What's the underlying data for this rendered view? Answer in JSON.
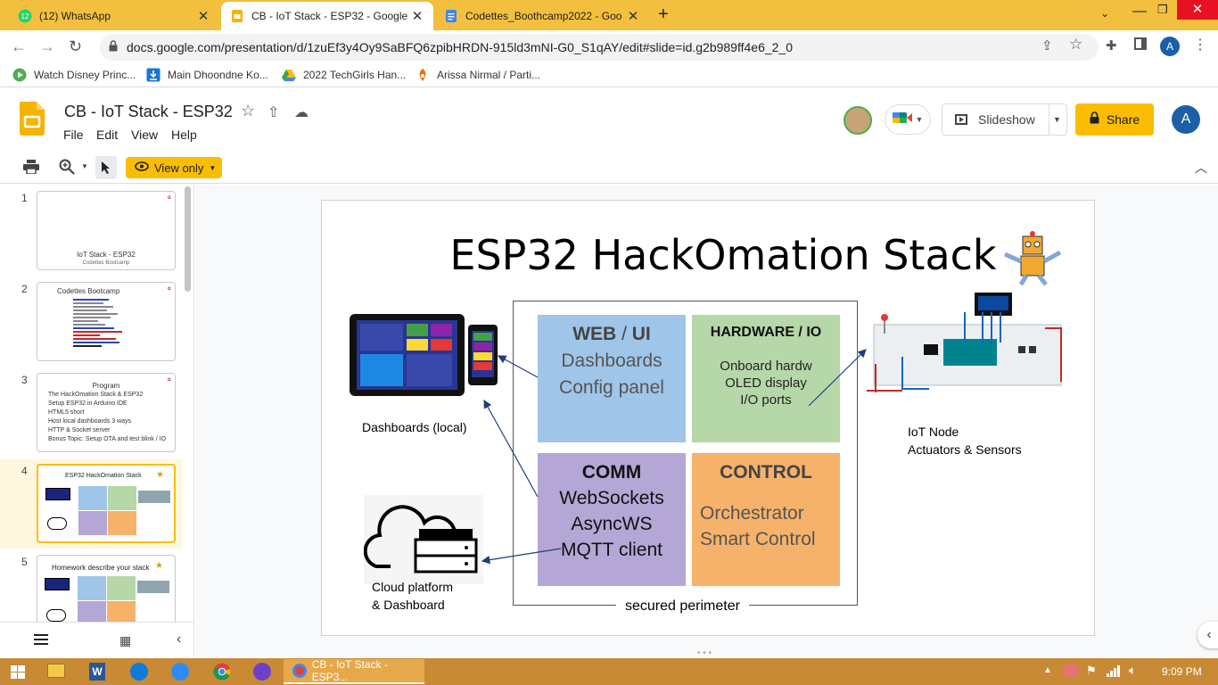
{
  "browser": {
    "tabs": [
      {
        "label": "(12) WhatsApp",
        "icon": "whatsapp-icon",
        "badge": "12"
      },
      {
        "label": "CB - IoT Stack - ESP32 - Google S",
        "icon": "slides-icon"
      },
      {
        "label": "Codettes_Boothcamp2022 - Goo",
        "icon": "docs-icon"
      }
    ],
    "url": "docs.google.com/presentation/d/1zuEf3y4Oy9SaBFQ6zpibHRDN-915ld3mNI-G0_S1qAY/edit#slide=id.g2b989ff4e6_2_0",
    "profile_letter": "A",
    "bookmarks": [
      {
        "label": "Watch Disney Princ..."
      },
      {
        "label": "Main Dhoondne Ko..."
      },
      {
        "label": "2022 TechGirls Han..."
      },
      {
        "label": "Arissa Nirmal / Parti..."
      }
    ]
  },
  "app": {
    "doc_title": "CB - IoT Stack - ESP32",
    "menus": [
      "File",
      "Edit",
      "View",
      "Help"
    ],
    "slideshow_label": "Slideshow",
    "share_label": "Share",
    "account_letter": "A",
    "view_only_label": "View only",
    "brand_color": "#f4b400"
  },
  "filmstrip": {
    "slides": [
      {
        "num": "1",
        "title": "IoT Stack - ESP32",
        "subtitle": "Codettes Bootcamp"
      },
      {
        "num": "2",
        "title": "Codettes Bootcamp"
      },
      {
        "num": "3",
        "title": "Program",
        "bullets": [
          "The HackOmation Stack & ESP32",
          "Setup ESP32 in Arduino IDE",
          "HTML5 short",
          "Host local dashboards 3 ways",
          "HTTP & Socket server",
          "Bonus Topic: Setup OTA and test blink / IO"
        ]
      },
      {
        "num": "4",
        "title": "ESP32 HackOmation Stack"
      },
      {
        "num": "5",
        "title": "Homework describe your stack"
      }
    ]
  },
  "slide": {
    "title": "ESP32 HackOmation Stack",
    "blocks": {
      "web": {
        "head1": "WEB",
        "sep": "/",
        "head2": "UI",
        "line1": "Dashboards",
        "line2": "Config panel",
        "color": "#9fc5e8"
      },
      "hardware": {
        "head": "HARDWARE / IO",
        "line1": "Onboard hardw",
        "line2": "OLED display",
        "line3": "I/O ports",
        "color": "#b6d7a8"
      },
      "comm": {
        "head": "COMM",
        "line1": "WebSockets",
        "line2": "AsyncWS",
        "line3": "MQTT client",
        "color": "#b4a7d6"
      },
      "control": {
        "head": "CONTROL",
        "line1": "Orchestrator",
        "line2": "Smart Control",
        "color": "#f6b26b"
      }
    },
    "perimeter_label": "secured perimeter",
    "dashboards_label": "Dashboards (local)",
    "cloud_label1": "Cloud platform",
    "cloud_label2": "& Dashboard",
    "iot_label1": "IoT Node",
    "iot_label2": "Actuators & Sensors"
  },
  "taskbar": {
    "active_window": "CB - IoT Stack - ESP3...",
    "time": "9:09 PM"
  }
}
